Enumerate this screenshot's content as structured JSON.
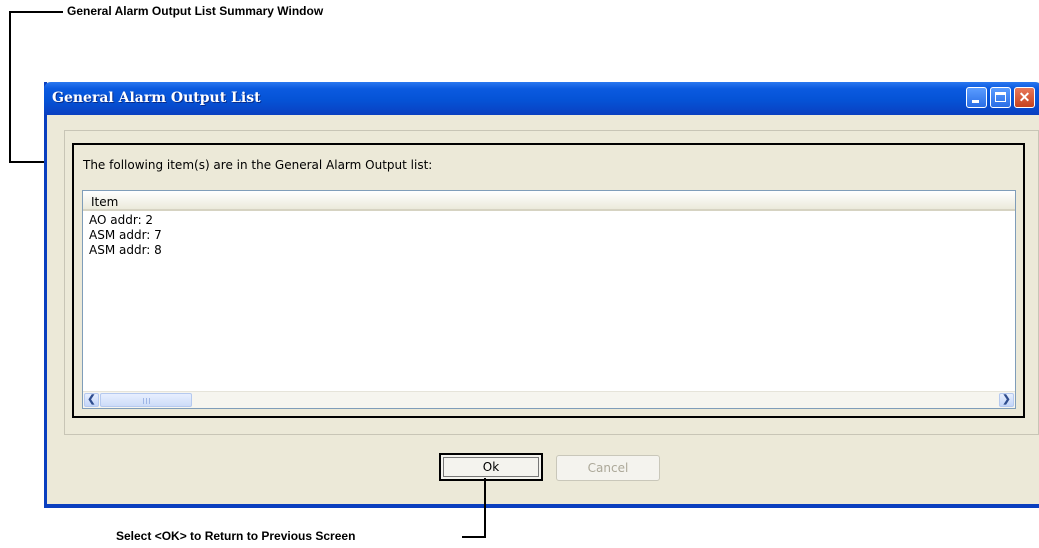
{
  "annotations": {
    "top": "General Alarm Output List Summary Window",
    "bottom": "Select <OK> to Return to Previous Screen"
  },
  "window": {
    "title": "General Alarm Output List",
    "prompt": "The following item(s) are in the General Alarm Output list:",
    "list": {
      "column_header": "Item",
      "rows": [
        "AO addr: 2",
        "ASM addr: 7",
        "ASM addr: 8"
      ]
    },
    "buttons": {
      "ok": "Ok",
      "cancel": "Cancel"
    }
  }
}
